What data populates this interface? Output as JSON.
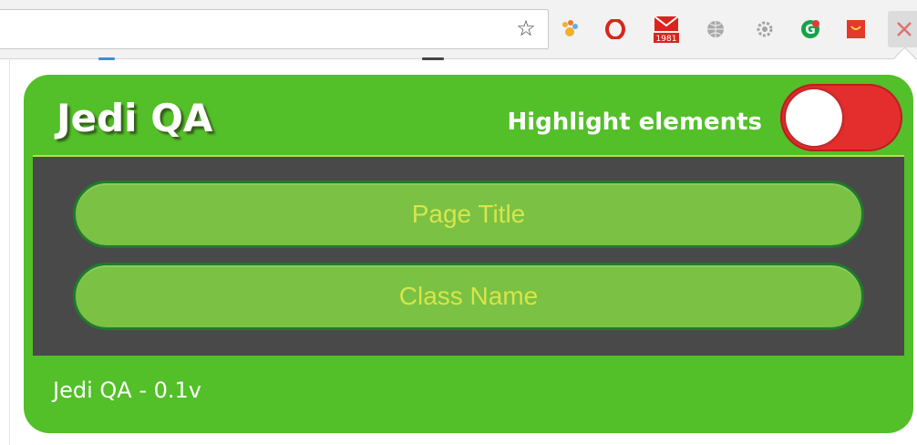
{
  "toolbar": {
    "bookmark_icon": "star-icon",
    "extensions": [
      {
        "name": "paw-extension-icon",
        "color": "#f0b030"
      },
      {
        "name": "opera-vpn-icon",
        "color": "#d9261c"
      },
      {
        "name": "mail-badge-icon",
        "color": "#d9261c",
        "badge": "1981"
      },
      {
        "name": "globe-icon",
        "color": "#9a9a9a"
      },
      {
        "name": "gear-extension-icon",
        "color": "#9a9a9a"
      },
      {
        "name": "grammarly-icon",
        "color": "#15a34a"
      },
      {
        "name": "shop-extension-icon",
        "color": "#e4392b"
      },
      {
        "name": "close-extension-icon",
        "color": "#e07070"
      }
    ]
  },
  "popup": {
    "title": "Jedi QA",
    "highlight_label": "Highlight elements",
    "toggle_state": "off",
    "buttons": {
      "page_title": "Page Title",
      "class_name": "Class Name"
    },
    "footer": "Jedi QA - 0.1v",
    "colors": {
      "header_green": "#53bf29",
      "body_gray": "#494949",
      "pill_green": "#7ac144",
      "pill_text": "#d6e64a",
      "toggle_red": "#e42e2e"
    }
  }
}
